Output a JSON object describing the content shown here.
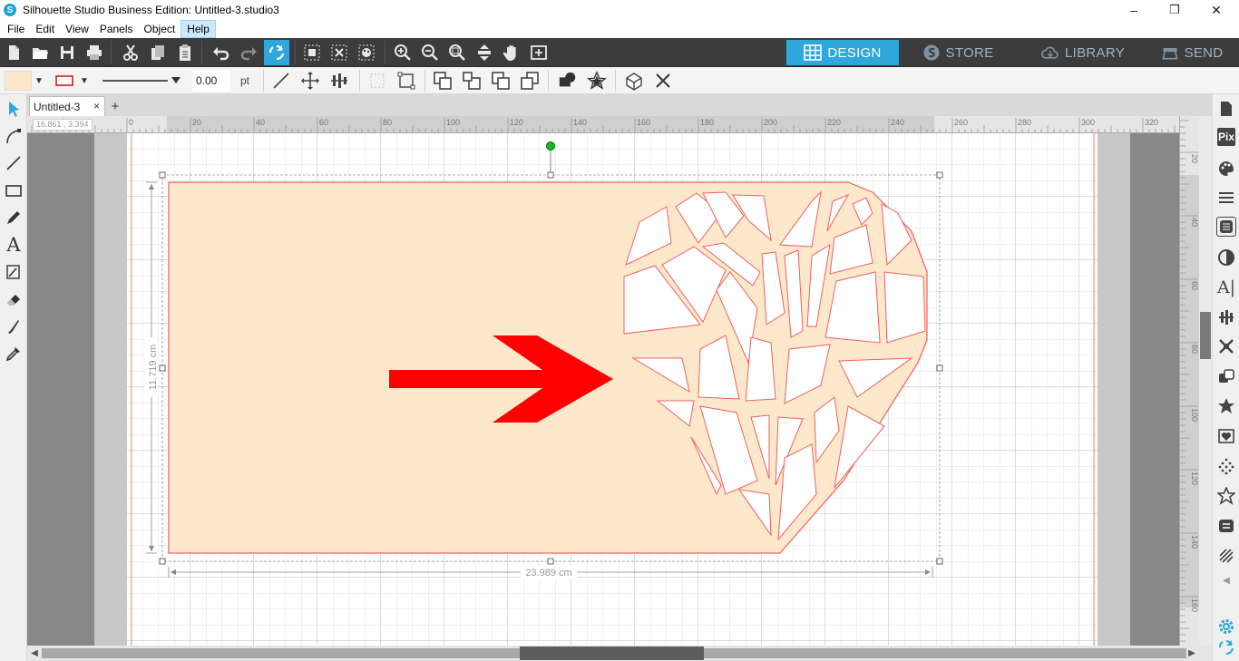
{
  "window": {
    "title": "Silhouette Studio Business Edition: Untitled-3.studio3",
    "controls": [
      "–",
      "❐",
      "✕"
    ]
  },
  "menu": {
    "items": [
      "File",
      "Edit",
      "View",
      "Panels",
      "Object",
      "Help"
    ],
    "active": "Help"
  },
  "nav_tabs": [
    {
      "label": "DESIGN",
      "icon": "grid-icon",
      "active": true
    },
    {
      "label": "STORE",
      "icon": "silhouette-s-icon",
      "active": false
    },
    {
      "label": "LIBRARY",
      "icon": "cloud-icon",
      "active": false
    },
    {
      "label": "SEND",
      "icon": "cutter-icon",
      "active": false
    }
  ],
  "line_style": {
    "width_value": "0.00",
    "unit": "pt"
  },
  "document": {
    "tab_label": "Untitled-3",
    "close_glyph": "×",
    "add_glyph": "+"
  },
  "ruler": {
    "h_labels": [
      "0",
      "20",
      "40",
      "60",
      "80",
      "100",
      "120",
      "140",
      "160",
      "180",
      "200",
      "220",
      "240",
      "260",
      "280",
      "300",
      "320"
    ],
    "v_labels": [
      "20",
      "40",
      "60",
      "80",
      "100",
      "120",
      "140",
      "160"
    ],
    "coord_readout": "16.861 , 3.394"
  },
  "selection": {
    "width": "23.989 cm",
    "height": "11.719 cm"
  },
  "colors": {
    "accent": "#2ea8dc",
    "fill": "#fde8cb",
    "cut_line": "#f06060",
    "arrow": "#ff0000",
    "toolbar_dark": "#3c3c3c"
  }
}
